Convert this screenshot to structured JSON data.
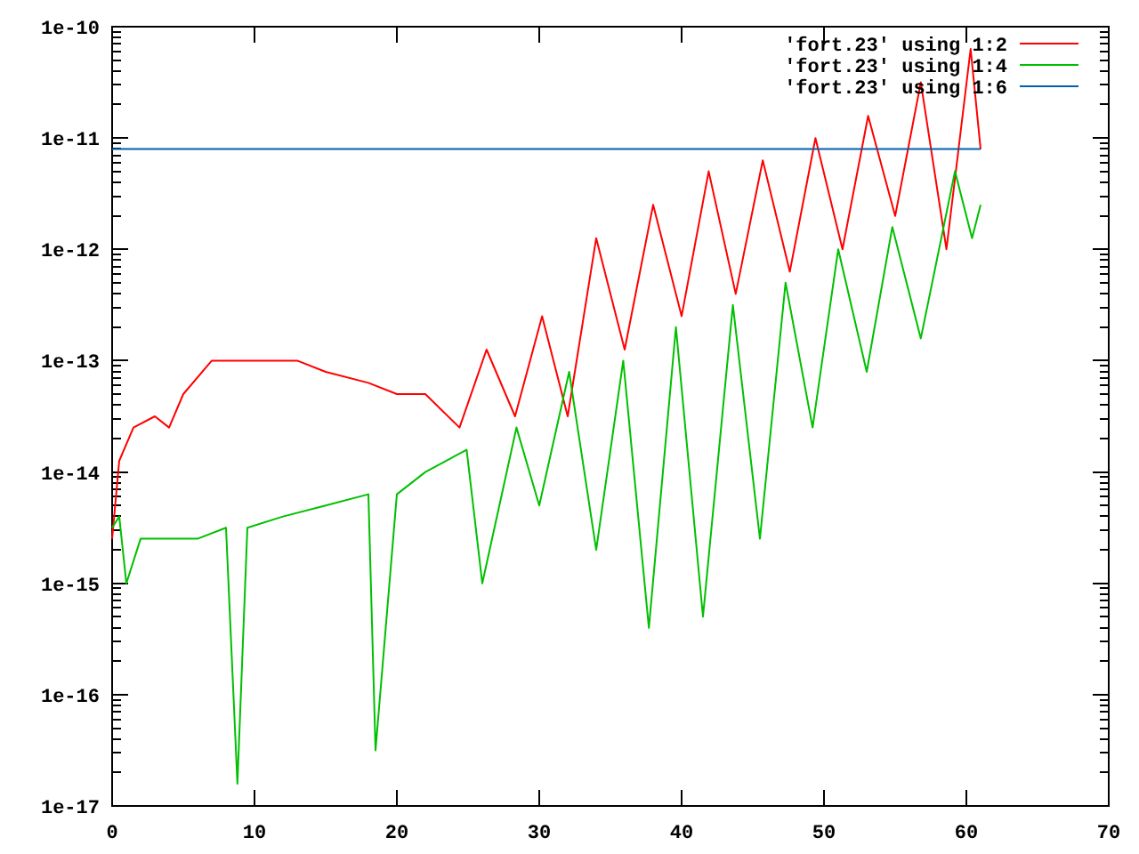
{
  "plot": {
    "x_ticks": [
      "0",
      "10",
      "20",
      "30",
      "40",
      "50",
      "60",
      "70"
    ],
    "y_ticks": [
      "1e-10",
      "1e-11",
      "1e-12",
      "1e-13",
      "1e-14",
      "1e-15",
      "1e-16",
      "1e-17"
    ],
    "legend": [
      {
        "label": "'fort.23' using 1:2",
        "color": "#ff0000"
      },
      {
        "label": "'fort.23' using 1:4",
        "color": "#00c000"
      },
      {
        "label": "'fort.23' using 1:6",
        "color": "#0060ad"
      }
    ]
  }
}
